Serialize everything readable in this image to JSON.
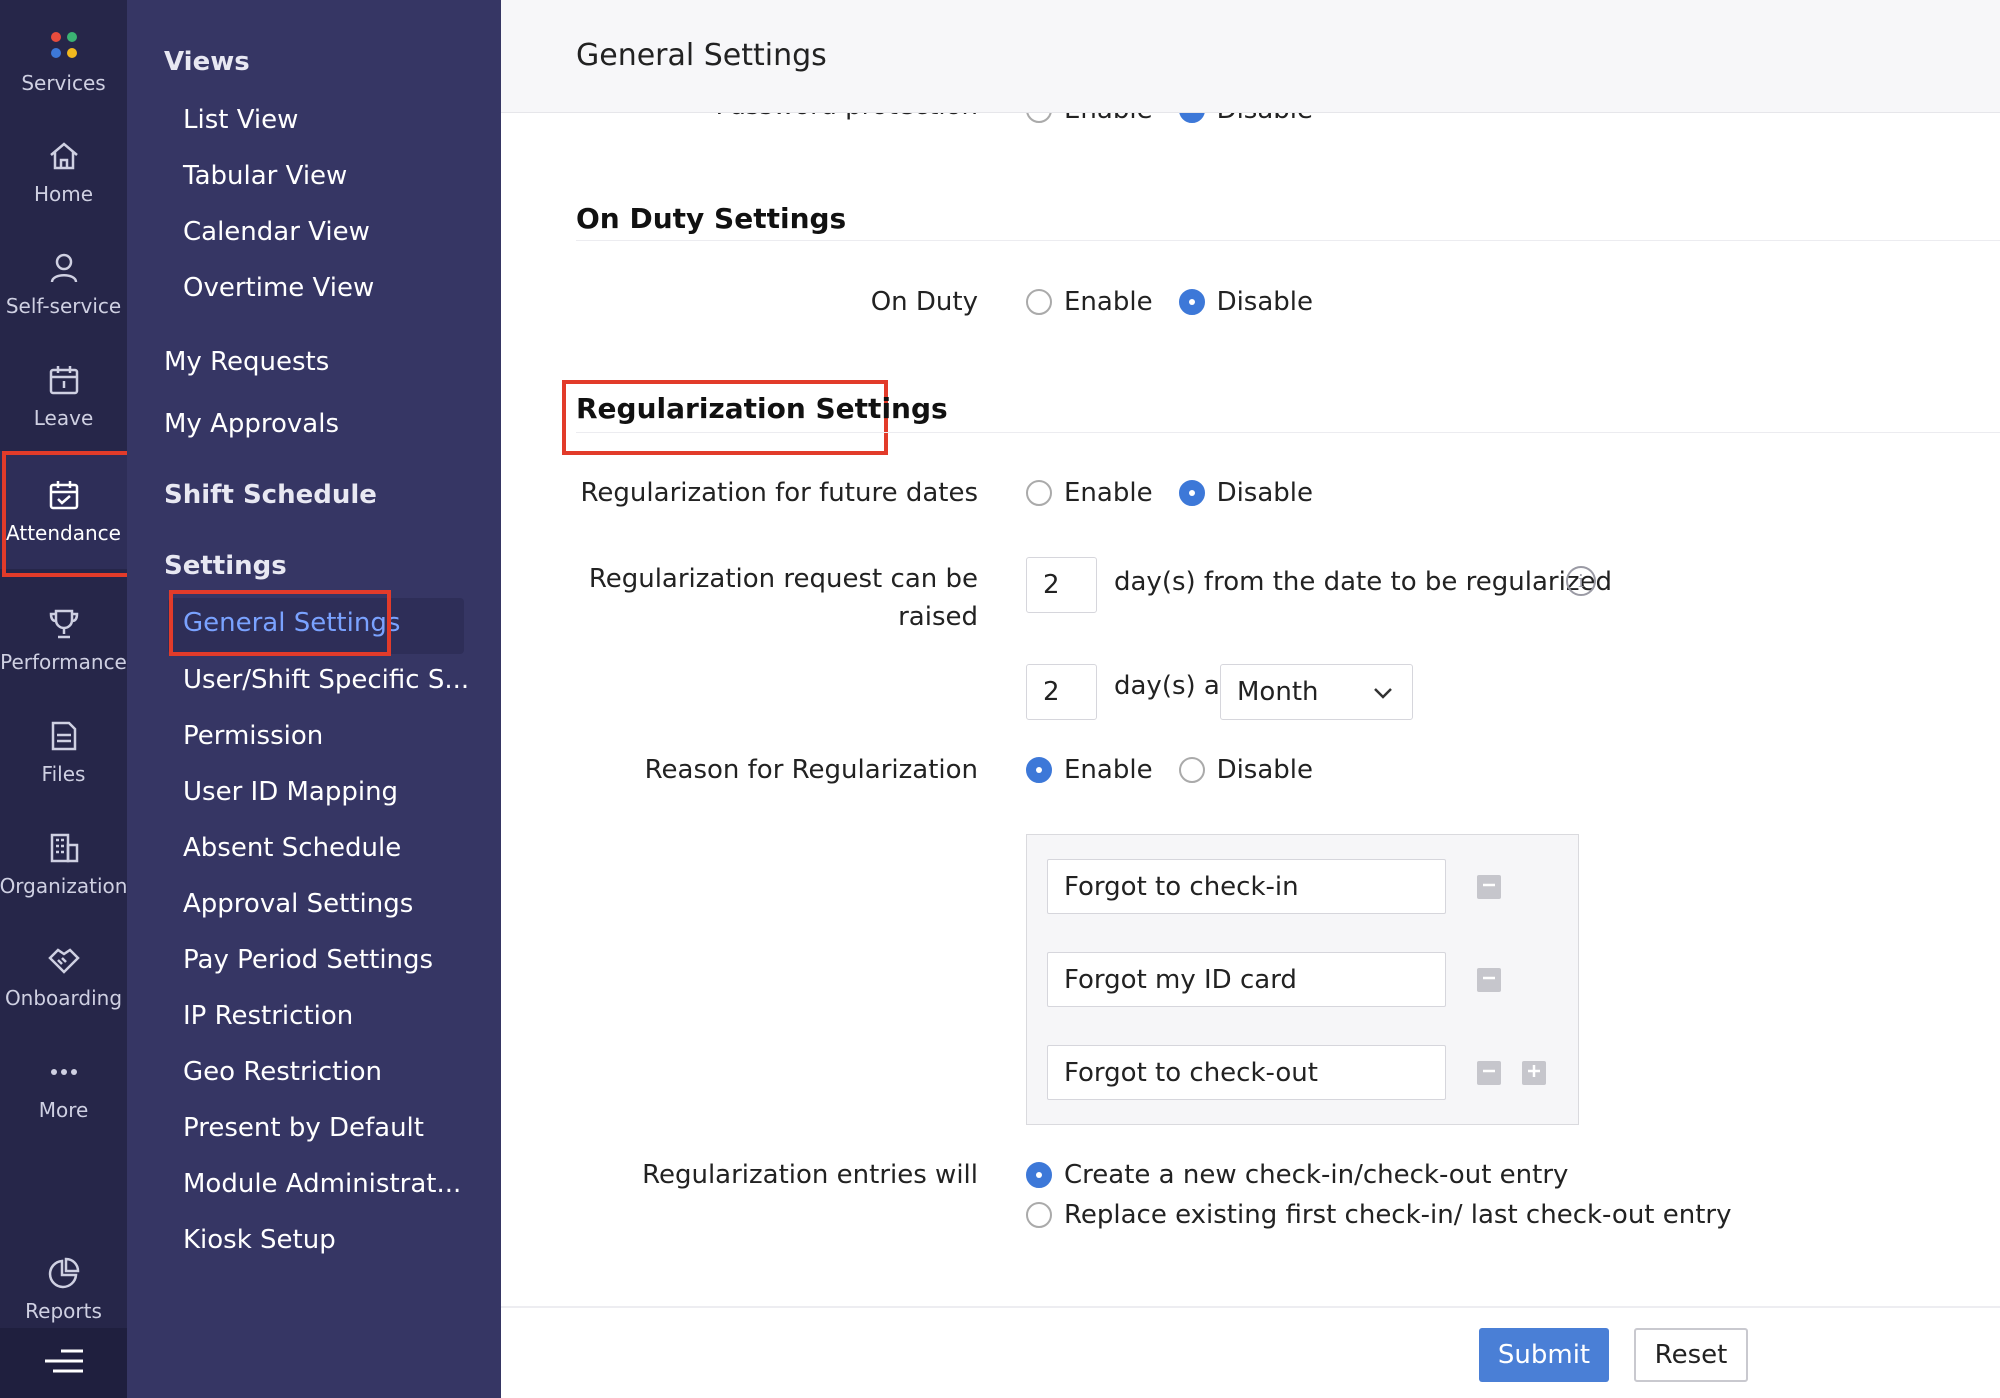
{
  "rail": {
    "items": [
      {
        "label": "Services",
        "icon": "services-icon"
      },
      {
        "label": "Home",
        "icon": "home-icon"
      },
      {
        "label": "Self-service",
        "icon": "user-icon"
      },
      {
        "label": "Leave",
        "icon": "calendar-icon"
      },
      {
        "label": "Attendance",
        "icon": "calendar-check-icon"
      },
      {
        "label": "Performance",
        "icon": "trophy-icon"
      },
      {
        "label": "Files",
        "icon": "folder-icon"
      },
      {
        "label": "Organization",
        "icon": "building-icon"
      },
      {
        "label": "Onboarding",
        "icon": "handshake-icon"
      },
      {
        "label": "More",
        "icon": "more-icon"
      },
      {
        "label": "Reports",
        "icon": "pie-chart-icon"
      }
    ],
    "active": "Attendance"
  },
  "nav": {
    "views_heading": "Views",
    "views": [
      "List View",
      "Tabular View",
      "Calendar View",
      "Overtime View"
    ],
    "my_requests": "My Requests",
    "my_approvals": "My Approvals",
    "shift_schedule": "Shift Schedule",
    "settings_heading": "Settings",
    "settings": [
      "General Settings",
      "User/Shift Specific S...",
      "Permission",
      "User ID Mapping",
      "Absent Schedule",
      "Approval Settings",
      "Pay Period Settings",
      "IP Restriction",
      "Geo Restriction",
      "Present by Default",
      "Module Administrat...",
      "Kiosk Setup"
    ],
    "active": "General Settings"
  },
  "header": {
    "title": "General Settings"
  },
  "cutoff": {
    "label": "Password protection",
    "enable": "Enable",
    "disable": "Disable"
  },
  "on_duty": {
    "title": "On Duty Settings",
    "label": "On Duty",
    "enable": "Enable",
    "disable": "Disable",
    "selected": "Disable"
  },
  "regularization": {
    "title": "Regularization Settings",
    "future_dates": {
      "label": "Regularization for future dates",
      "enable": "Enable",
      "disable": "Disable",
      "selected": "Disable"
    },
    "request_raised": {
      "label_line1": "Regularization request can be",
      "label_line2": "raised",
      "days_value": "2",
      "days_text": "day(s) from the date to be regularized",
      "count_value": "2",
      "count_text": "day(s) a",
      "period_value": "Month"
    },
    "reason": {
      "label": "Reason for Regularization",
      "enable": "Enable",
      "disable": "Disable",
      "selected": "Enable"
    },
    "reasons": [
      "Forgot to check-in",
      "Forgot my ID card",
      "Forgot to check-out"
    ],
    "entries": {
      "label": "Regularization entries will",
      "option1": "Create a new check-in/check-out entry",
      "option2": "Replace existing first check-in/ last check-out entry",
      "selected": "option1"
    }
  },
  "footer": {
    "submit": "Submit",
    "reset": "Reset"
  },
  "colors": {
    "rail_bg": "#262649",
    "nav_bg": "#363664",
    "accent": "#4a7fd6",
    "highlight": "#e23b2a"
  }
}
